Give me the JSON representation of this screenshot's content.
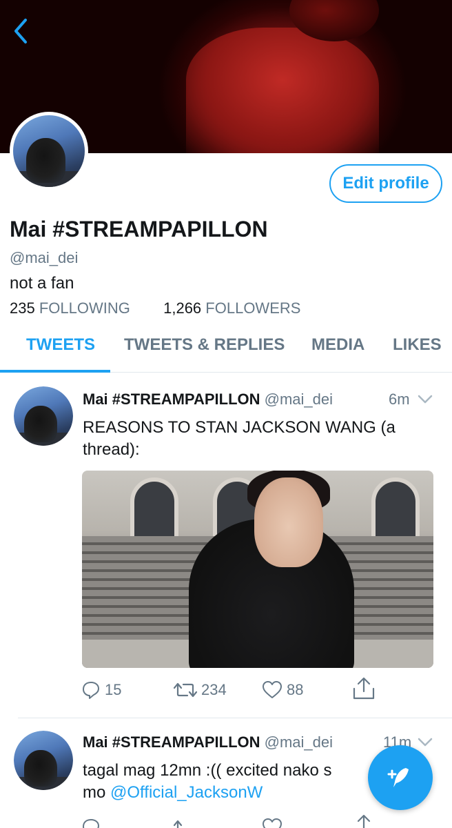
{
  "profile": {
    "name": "Mai #STREAMPAPILLON",
    "handle": "@mai_dei",
    "bio": "not a fan",
    "following_count": "235",
    "following_label": "FOLLOWING",
    "followers_count": "1,266",
    "followers_label": "FOLLOWERS",
    "edit_label": "Edit profile"
  },
  "tabs": [
    {
      "label": "TWEETS",
      "active": true
    },
    {
      "label": "TWEETS & REPLIES",
      "active": false
    },
    {
      "label": "MEDIA",
      "active": false
    },
    {
      "label": "LIKES",
      "active": false
    }
  ],
  "tweets": [
    {
      "name": "Mai #STREAMPAPILLON",
      "handle": "@mai_dei",
      "time": "6m",
      "text_line1": "REASONS TO STAN JACKSON WANG (a",
      "text_line2": "thread):",
      "replies": "15",
      "retweets": "234",
      "likes": "88"
    },
    {
      "name": "Mai #STREAMPAPILLON",
      "handle": "@mai_dei",
      "time": "11m",
      "text_line1": "tagal mag 12mn :(( excited nako s",
      "text_line2_prefix": "mo ",
      "mention": "@Official_JacksonW"
    }
  ],
  "colors": {
    "accent": "#1da1f2",
    "secondary_text": "#657786",
    "primary_text": "#14171a",
    "divider": "#e1e8ed"
  },
  "icons": [
    "back-chevron-icon",
    "caret-down-icon",
    "reply-icon",
    "retweet-icon",
    "like-icon",
    "share-icon",
    "compose-tweet-icon"
  ]
}
